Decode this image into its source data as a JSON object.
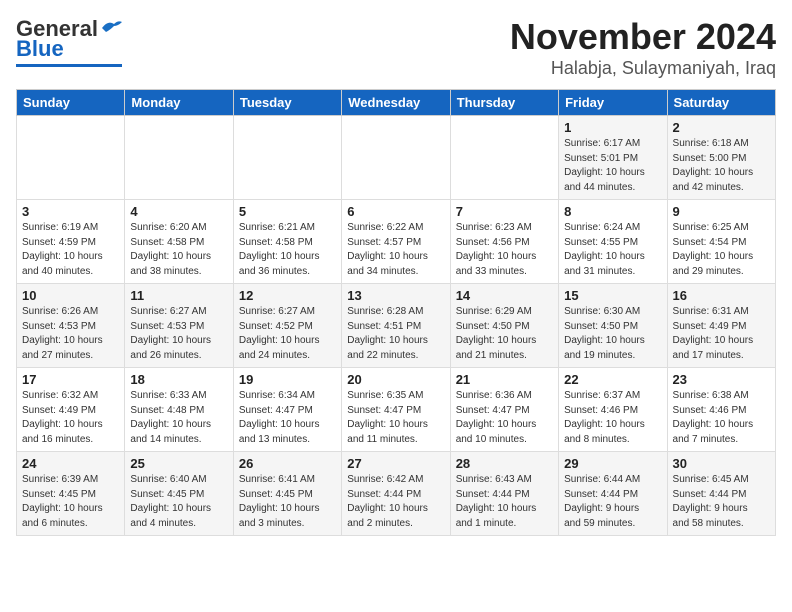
{
  "header": {
    "logo_general": "General",
    "logo_blue": "Blue",
    "title": "November 2024",
    "subtitle": "Halabja, Sulaymaniyah, Iraq"
  },
  "weekdays": [
    "Sunday",
    "Monday",
    "Tuesday",
    "Wednesday",
    "Thursday",
    "Friday",
    "Saturday"
  ],
  "weeks": [
    [
      {
        "day": "",
        "info": ""
      },
      {
        "day": "",
        "info": ""
      },
      {
        "day": "",
        "info": ""
      },
      {
        "day": "",
        "info": ""
      },
      {
        "day": "",
        "info": ""
      },
      {
        "day": "1",
        "info": "Sunrise: 6:17 AM\nSunset: 5:01 PM\nDaylight: 10 hours\nand 44 minutes."
      },
      {
        "day": "2",
        "info": "Sunrise: 6:18 AM\nSunset: 5:00 PM\nDaylight: 10 hours\nand 42 minutes."
      }
    ],
    [
      {
        "day": "3",
        "info": "Sunrise: 6:19 AM\nSunset: 4:59 PM\nDaylight: 10 hours\nand 40 minutes."
      },
      {
        "day": "4",
        "info": "Sunrise: 6:20 AM\nSunset: 4:58 PM\nDaylight: 10 hours\nand 38 minutes."
      },
      {
        "day": "5",
        "info": "Sunrise: 6:21 AM\nSunset: 4:58 PM\nDaylight: 10 hours\nand 36 minutes."
      },
      {
        "day": "6",
        "info": "Sunrise: 6:22 AM\nSunset: 4:57 PM\nDaylight: 10 hours\nand 34 minutes."
      },
      {
        "day": "7",
        "info": "Sunrise: 6:23 AM\nSunset: 4:56 PM\nDaylight: 10 hours\nand 33 minutes."
      },
      {
        "day": "8",
        "info": "Sunrise: 6:24 AM\nSunset: 4:55 PM\nDaylight: 10 hours\nand 31 minutes."
      },
      {
        "day": "9",
        "info": "Sunrise: 6:25 AM\nSunset: 4:54 PM\nDaylight: 10 hours\nand 29 minutes."
      }
    ],
    [
      {
        "day": "10",
        "info": "Sunrise: 6:26 AM\nSunset: 4:53 PM\nDaylight: 10 hours\nand 27 minutes."
      },
      {
        "day": "11",
        "info": "Sunrise: 6:27 AM\nSunset: 4:53 PM\nDaylight: 10 hours\nand 26 minutes."
      },
      {
        "day": "12",
        "info": "Sunrise: 6:27 AM\nSunset: 4:52 PM\nDaylight: 10 hours\nand 24 minutes."
      },
      {
        "day": "13",
        "info": "Sunrise: 6:28 AM\nSunset: 4:51 PM\nDaylight: 10 hours\nand 22 minutes."
      },
      {
        "day": "14",
        "info": "Sunrise: 6:29 AM\nSunset: 4:50 PM\nDaylight: 10 hours\nand 21 minutes."
      },
      {
        "day": "15",
        "info": "Sunrise: 6:30 AM\nSunset: 4:50 PM\nDaylight: 10 hours\nand 19 minutes."
      },
      {
        "day": "16",
        "info": "Sunrise: 6:31 AM\nSunset: 4:49 PM\nDaylight: 10 hours\nand 17 minutes."
      }
    ],
    [
      {
        "day": "17",
        "info": "Sunrise: 6:32 AM\nSunset: 4:49 PM\nDaylight: 10 hours\nand 16 minutes."
      },
      {
        "day": "18",
        "info": "Sunrise: 6:33 AM\nSunset: 4:48 PM\nDaylight: 10 hours\nand 14 minutes."
      },
      {
        "day": "19",
        "info": "Sunrise: 6:34 AM\nSunset: 4:47 PM\nDaylight: 10 hours\nand 13 minutes."
      },
      {
        "day": "20",
        "info": "Sunrise: 6:35 AM\nSunset: 4:47 PM\nDaylight: 10 hours\nand 11 minutes."
      },
      {
        "day": "21",
        "info": "Sunrise: 6:36 AM\nSunset: 4:47 PM\nDaylight: 10 hours\nand 10 minutes."
      },
      {
        "day": "22",
        "info": "Sunrise: 6:37 AM\nSunset: 4:46 PM\nDaylight: 10 hours\nand 8 minutes."
      },
      {
        "day": "23",
        "info": "Sunrise: 6:38 AM\nSunset: 4:46 PM\nDaylight: 10 hours\nand 7 minutes."
      }
    ],
    [
      {
        "day": "24",
        "info": "Sunrise: 6:39 AM\nSunset: 4:45 PM\nDaylight: 10 hours\nand 6 minutes."
      },
      {
        "day": "25",
        "info": "Sunrise: 6:40 AM\nSunset: 4:45 PM\nDaylight: 10 hours\nand 4 minutes."
      },
      {
        "day": "26",
        "info": "Sunrise: 6:41 AM\nSunset: 4:45 PM\nDaylight: 10 hours\nand 3 minutes."
      },
      {
        "day": "27",
        "info": "Sunrise: 6:42 AM\nSunset: 4:44 PM\nDaylight: 10 hours\nand 2 minutes."
      },
      {
        "day": "28",
        "info": "Sunrise: 6:43 AM\nSunset: 4:44 PM\nDaylight: 10 hours\nand 1 minute."
      },
      {
        "day": "29",
        "info": "Sunrise: 6:44 AM\nSunset: 4:44 PM\nDaylight: 9 hours\nand 59 minutes."
      },
      {
        "day": "30",
        "info": "Sunrise: 6:45 AM\nSunset: 4:44 PM\nDaylight: 9 hours\nand 58 minutes."
      }
    ]
  ]
}
